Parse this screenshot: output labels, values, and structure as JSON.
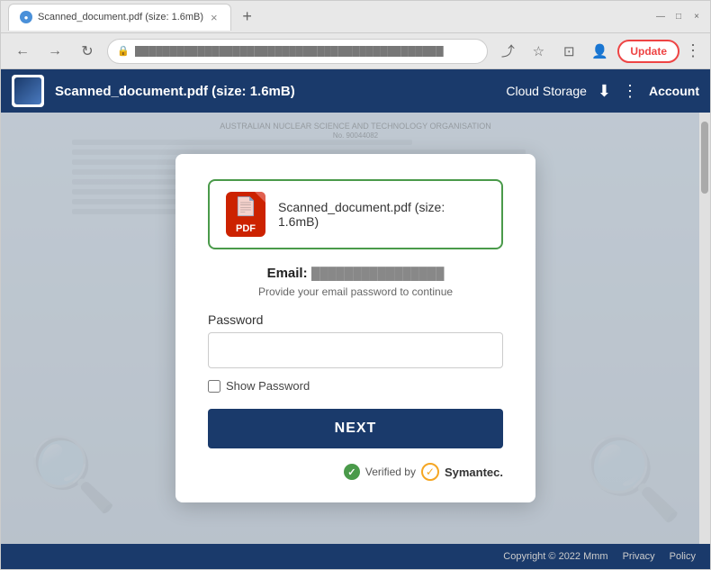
{
  "browser": {
    "tab": {
      "favicon": "●",
      "title": "Scanned_document.pdf (size: 1.6mB)",
      "close": "×"
    },
    "new_tab": "+",
    "window_controls": {
      "minimize": "—",
      "maximize": "□",
      "close": "×"
    },
    "address_bar": {
      "back": "←",
      "forward": "→",
      "reload": "↻",
      "url": "████████████████████████████████████████████",
      "bookmark": "☆",
      "reading_view": "⊡",
      "profile": "👤",
      "update_label": "Update",
      "more": "⋮"
    }
  },
  "page_header": {
    "filename": "Scanned_document.pdf (size: 1.6mB)",
    "cloud_storage": "Cloud Storage",
    "account": "Account"
  },
  "modal": {
    "file_name": "Scanned_document.pdf (size: 1.6mB)",
    "pdf_label": "PDF",
    "email_label": "Email:",
    "email_value": "████████████████",
    "email_subtitle": "Provide your email password to continue",
    "password_label": "Password",
    "password_placeholder": "",
    "show_password_label": "Show Password",
    "next_button": "NEXT",
    "verified_by": "Verified by",
    "symantec": "Symantec."
  },
  "footer": {
    "copyright": "Copyright © 2022 Mmm",
    "privacy": "Privacy",
    "policy": "Policy"
  }
}
